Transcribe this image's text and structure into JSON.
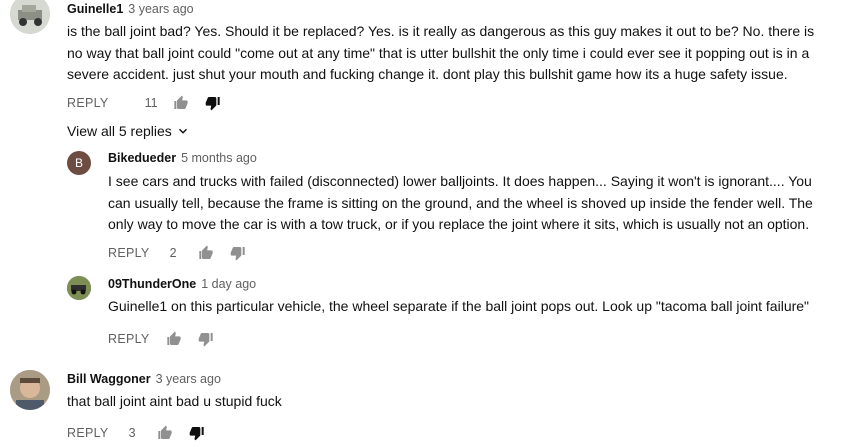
{
  "comments": [
    {
      "author": "Guinelle1",
      "time": "3 years ago",
      "text": "is the ball joint bad? Yes. Should it be replaced? Yes. is it really as dangerous as this guy makes it out to be? No. there is no way that ball joint could \"come out at any time\" that is utter bullshit the only time i could ever see it popping out is in a severe accident. just shut your mouth and fucking change it. dont play this bullshit game how its a huge safety issue.",
      "reply_label": "REPLY",
      "likes": "11"
    },
    {
      "author": "Bill Waggoner",
      "time": "3 years ago",
      "text": "that ball joint aint bad u stupid fuck",
      "reply_label": "REPLY",
      "likes": "3"
    }
  ],
  "view_replies_label": "View all 5 replies",
  "replies": [
    {
      "author": "Bikedueder",
      "avatar_letter": "B",
      "time": "5 months ago",
      "text": "I see cars and trucks with failed (disconnected) lower balljoints. It does happen... Saying it won't is ignorant.... You can usually tell, because the frame is sitting on the ground, and the wheel is shoved up inside the fender well. The only way to move the car is with a tow truck, or if you replace the joint where it sits, which is usually not an option.",
      "reply_label": "REPLY",
      "likes": "2"
    },
    {
      "author": "09ThunderOne",
      "time": "1 day ago",
      "text": "Guinelle1 on this particular vehicle, the wheel separate if the ball joint pops out. Look up \"tacoma ball joint failure\"",
      "reply_label": "REPLY",
      "likes": ""
    }
  ],
  "colors": {
    "avatar_b_bg": "#6d4c41",
    "meta_gray": "#606060",
    "text": "#111111"
  }
}
